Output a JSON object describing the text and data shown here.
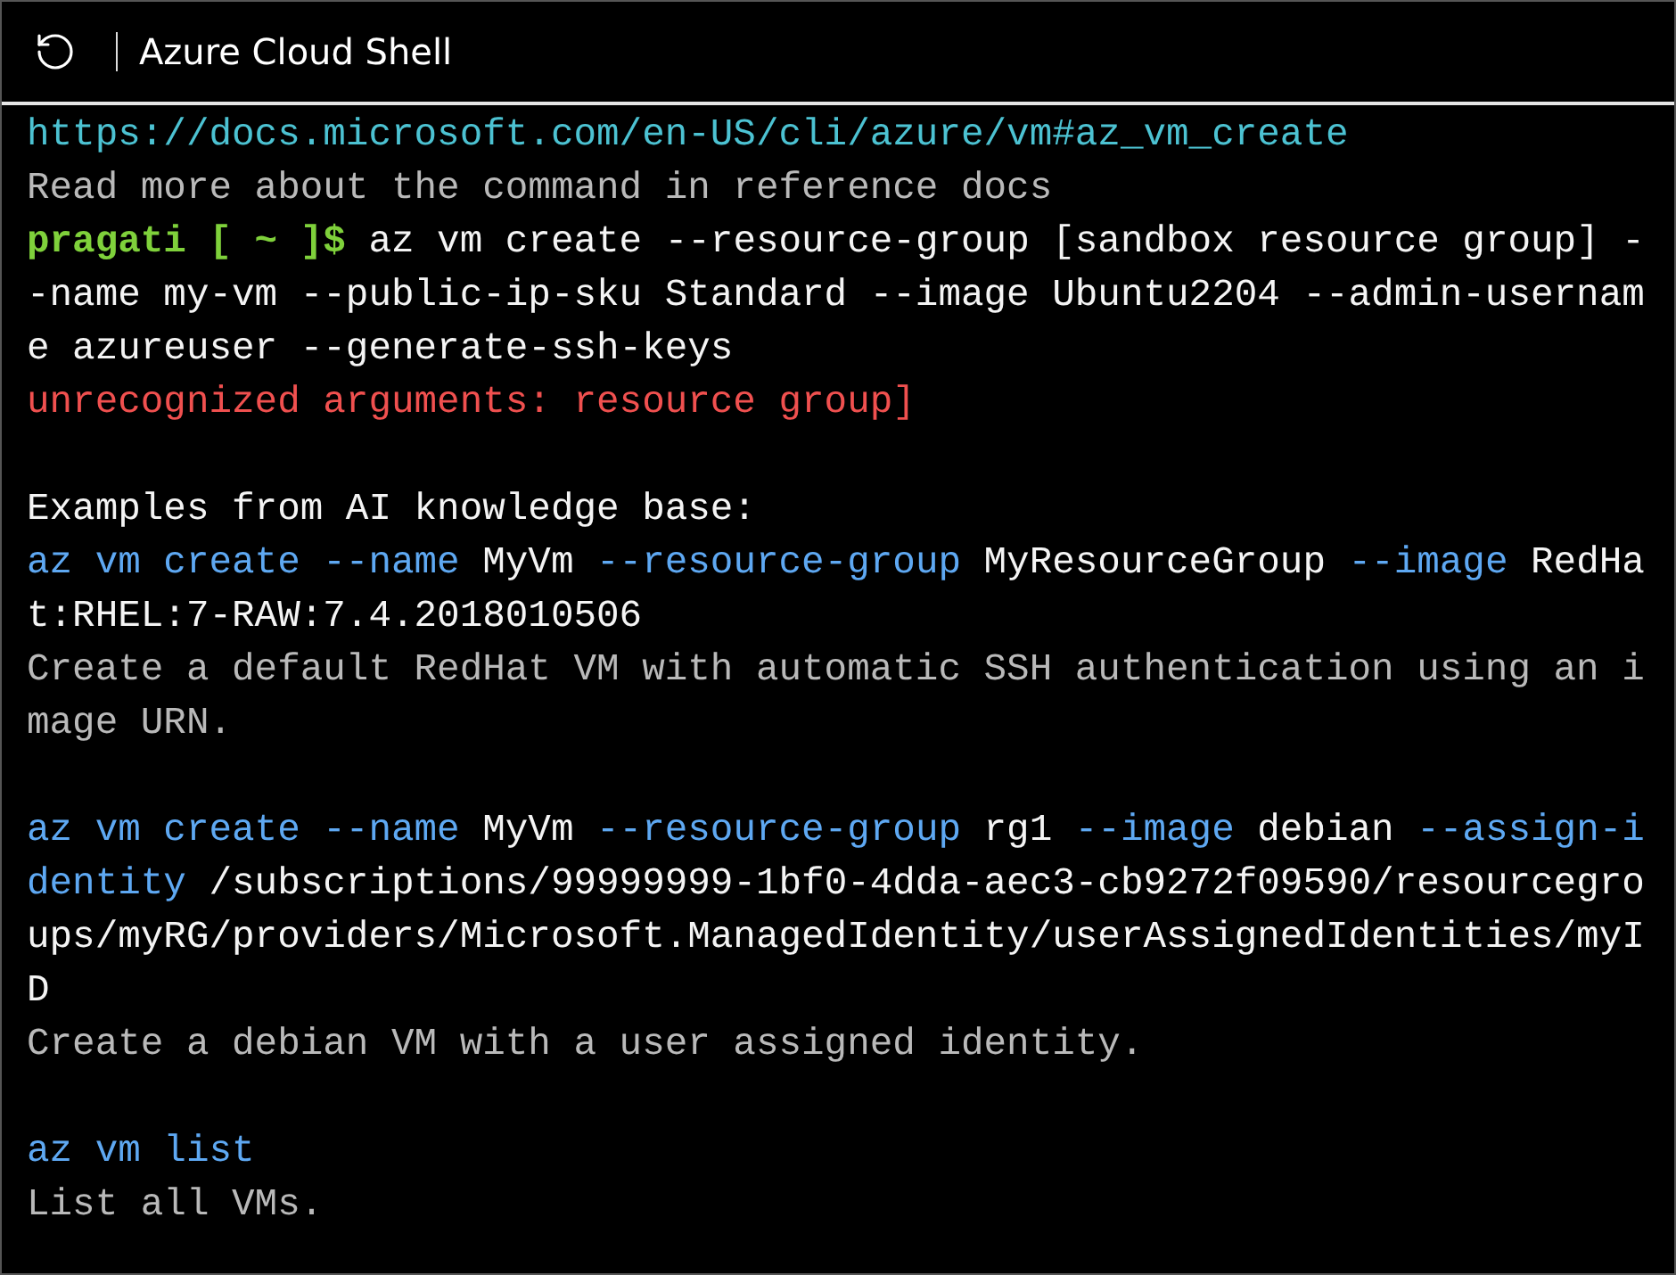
{
  "window": {
    "title": "Azure Cloud Shell"
  },
  "terminal": {
    "lines": [
      {
        "kind": "text",
        "segments": [
          {
            "kind": "url",
            "text": "https://docs.microsoft.com/en-US/cli/azure/vm#az_vm_create"
          }
        ]
      },
      {
        "kind": "text",
        "segments": [
          {
            "kind": "note",
            "text": "Read more about the command in reference docs"
          }
        ]
      },
      {
        "kind": "text",
        "segments": [
          {
            "kind": "prompt",
            "text": "pragati [ ~ ]$"
          },
          {
            "kind": "plain",
            "text": " az vm create --resource-group [sandbox resource group] -"
          }
        ]
      },
      {
        "kind": "text",
        "segments": [
          {
            "kind": "plain",
            "text": "-name my-vm --public-ip-sku Standard --image Ubuntu2204 --admin-usernam"
          }
        ]
      },
      {
        "kind": "text",
        "segments": [
          {
            "kind": "plain",
            "text": "e azureuser --generate-ssh-keys"
          }
        ]
      },
      {
        "kind": "text",
        "segments": [
          {
            "kind": "error",
            "text": "unrecognized arguments: resource group]"
          }
        ]
      },
      {
        "kind": "blank"
      },
      {
        "kind": "text",
        "segments": [
          {
            "kind": "plain",
            "text": "Examples from AI knowledge base:"
          }
        ]
      },
      {
        "kind": "text",
        "segments": [
          {
            "kind": "command",
            "text": "az vm create --name "
          },
          {
            "kind": "plain",
            "text": "MyVm "
          },
          {
            "kind": "command",
            "text": "--resource-group "
          },
          {
            "kind": "plain",
            "text": "MyResourceGroup "
          },
          {
            "kind": "command",
            "text": "--image "
          },
          {
            "kind": "plain",
            "text": "RedHa"
          }
        ]
      },
      {
        "kind": "text",
        "segments": [
          {
            "kind": "plain",
            "text": "t:RHEL:7-RAW:7.4.2018010506"
          }
        ]
      },
      {
        "kind": "text",
        "segments": [
          {
            "kind": "note",
            "text": "Create a default RedHat VM with automatic SSH authentication using an i"
          }
        ]
      },
      {
        "kind": "text",
        "segments": [
          {
            "kind": "note",
            "text": "mage URN."
          }
        ]
      },
      {
        "kind": "blank"
      },
      {
        "kind": "text",
        "segments": [
          {
            "kind": "command",
            "text": "az vm create --name "
          },
          {
            "kind": "plain",
            "text": "MyVm "
          },
          {
            "kind": "command",
            "text": "--resource-group "
          },
          {
            "kind": "plain",
            "text": "rg1 "
          },
          {
            "kind": "command",
            "text": "--image "
          },
          {
            "kind": "plain",
            "text": "debian "
          },
          {
            "kind": "command",
            "text": "--assign-i"
          }
        ]
      },
      {
        "kind": "text",
        "segments": [
          {
            "kind": "command",
            "text": "dentity "
          },
          {
            "kind": "plain",
            "text": "/subscriptions/99999999-1bf0-4dda-aec3-cb9272f09590/resourcegro"
          }
        ]
      },
      {
        "kind": "text",
        "segments": [
          {
            "kind": "plain",
            "text": "ups/myRG/providers/Microsoft.ManagedIdentity/userAssignedIdentities/myI"
          }
        ]
      },
      {
        "kind": "text",
        "segments": [
          {
            "kind": "plain",
            "text": "D"
          }
        ]
      },
      {
        "kind": "text",
        "segments": [
          {
            "kind": "note",
            "text": "Create a debian VM with a user assigned identity."
          }
        ]
      },
      {
        "kind": "blank"
      },
      {
        "kind": "text",
        "segments": [
          {
            "kind": "command",
            "text": "az vm list"
          }
        ]
      },
      {
        "kind": "text",
        "segments": [
          {
            "kind": "note",
            "text": "List all VMs."
          }
        ]
      }
    ]
  }
}
